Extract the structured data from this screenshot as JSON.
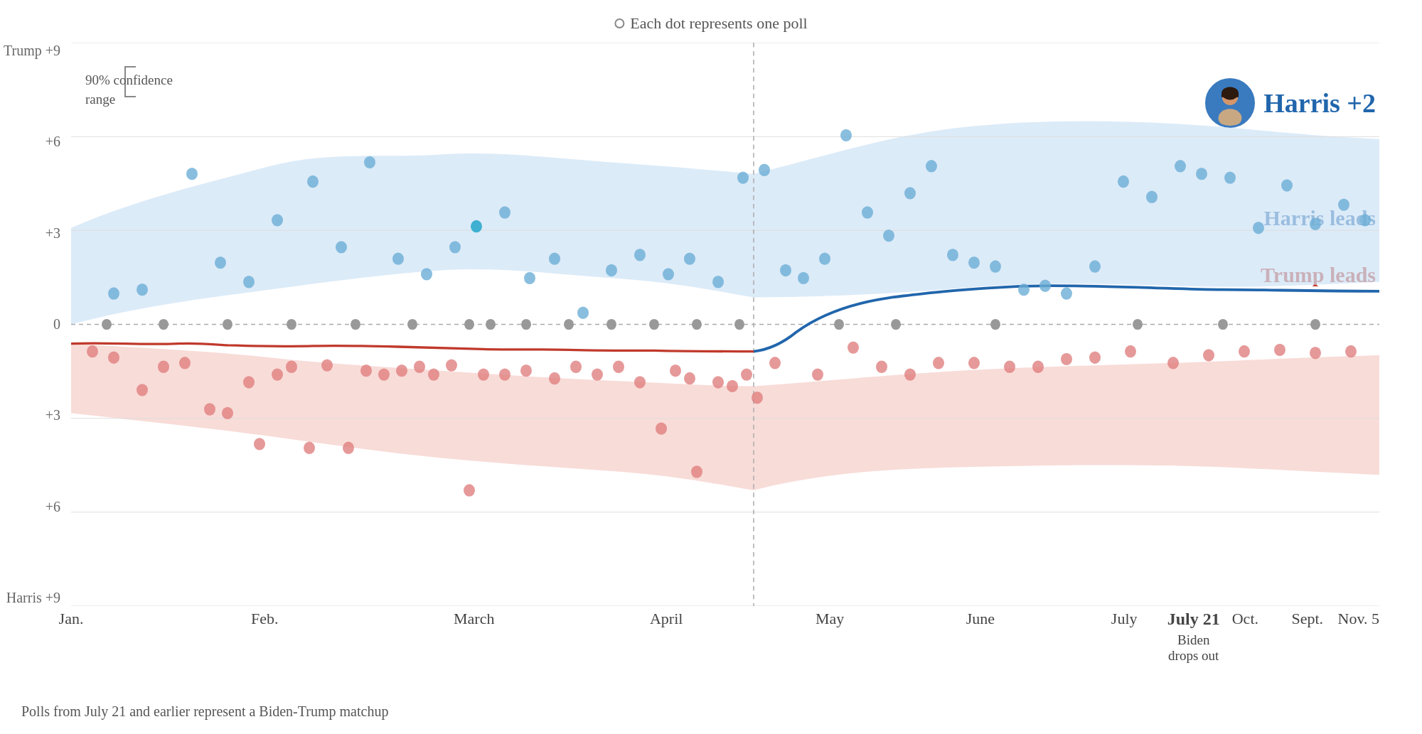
{
  "chart": {
    "title": "Each dot represents one poll",
    "legend_dot_label": "Each dot represents one poll",
    "confidence_range_label": "90% confidence\nrange",
    "harris_label": "Harris leads",
    "trump_label": "Trump leads",
    "harris_badge": "Harris +2",
    "footnote": "Polls from July 21 and earlier represent a Biden-Trump matchup",
    "y_labels": [
      "Trump +9",
      "+6",
      "+3",
      "0",
      "+3",
      "+6",
      "Harris +9"
    ],
    "x_labels": [
      {
        "label": "Jan.",
        "bold": false
      },
      {
        "label": "Feb.",
        "bold": false
      },
      {
        "label": "March",
        "bold": false
      },
      {
        "label": "April",
        "bold": false
      },
      {
        "label": "May",
        "bold": false
      },
      {
        "label": "June",
        "bold": false
      },
      {
        "label": "July",
        "bold": false
      },
      {
        "label": "July 21",
        "bold": true,
        "sublabel": "Biden\ndrops out"
      },
      {
        "label": "Sept.",
        "bold": false
      },
      {
        "label": "Oct.",
        "bold": false
      },
      {
        "label": "Nov. 5",
        "bold": false
      }
    ]
  }
}
